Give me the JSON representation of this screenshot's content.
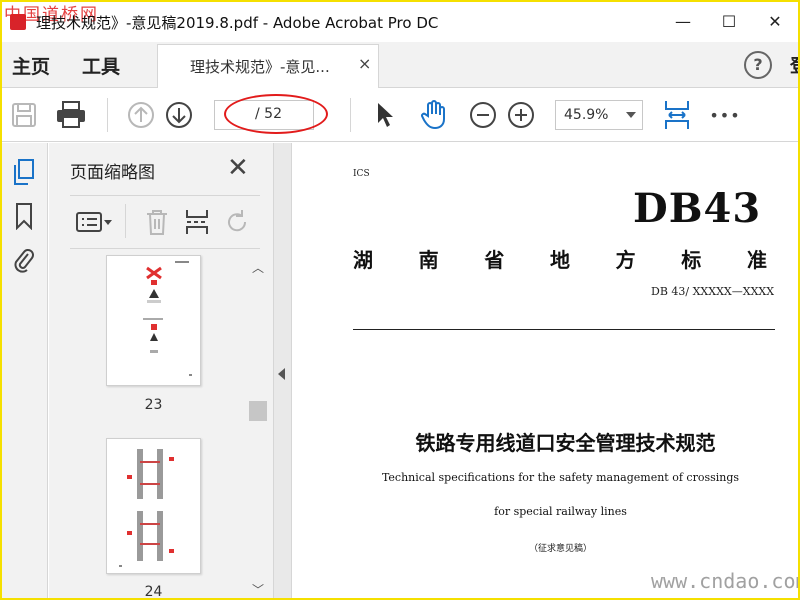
{
  "window": {
    "watermark_top": "中国道桥网",
    "title": "理技术规范》-意见稿2019.8.pdf - Adobe Acrobat Pro DC",
    "minimize": "—",
    "maximize": "☐",
    "close": "✕"
  },
  "tabs": {
    "home": "主页",
    "tools": "工具",
    "document": "理技术规范》-意见...",
    "document_close": "×",
    "help": "?",
    "cut_off": "登"
  },
  "toolbar": {
    "page_total": "/ 52",
    "zoom": "45.9%",
    "more": "•••"
  },
  "thumbnail_panel": {
    "title": "页面缩略图",
    "close": "✕",
    "thumbnails": [
      {
        "page": "23"
      },
      {
        "page": "24"
      }
    ]
  },
  "document": {
    "ics": "ICS",
    "standard_code": "DB43",
    "province_chars": [
      "湖",
      "南",
      "省",
      "地",
      "方",
      "标",
      "准"
    ],
    "std_number": "DB 43/  XXXXX—XXXX",
    "title_cn": "铁路专用线道口安全管理技术规范",
    "title_en_line1": "Technical specifications for the safety management of crossings",
    "title_en_line2": "for special railway lines",
    "draft_note": "（征求意见稿）"
  },
  "watermark_bottom": "www.cndao.com",
  "colors": {
    "accent_blue": "#1a73c8",
    "frame_yellow": "#f5e000",
    "annotation_red": "#e21b1b"
  }
}
